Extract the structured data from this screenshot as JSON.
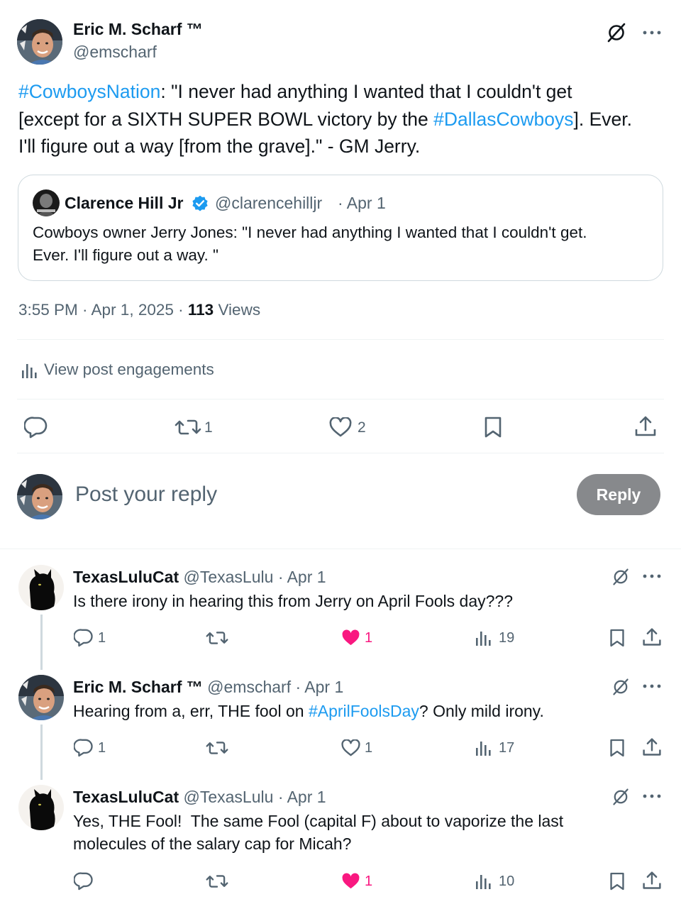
{
  "main_post": {
    "author_name": "Eric M. Scharf ™",
    "author_handle": "@emscharf",
    "text_hashtag_1": "#CowboysNation",
    "text_part_1": ": \"I never had anything I wanted that I couldn't get",
    "text_part_2": "[except for a SIXTH SUPER BOWL victory by the ",
    "text_hashtag_2": "#DallasCowboys",
    "text_part_3": "]. Ever.",
    "text_part_4": "I'll figure out a way [from the grave].\" - GM Jerry.",
    "quoted": {
      "author_name": "Clarence Hill Jr",
      "author_handle": "@clarencehilljr",
      "date": "· Apr 1",
      "text_line_1": "Cowboys owner Jerry Jones: \"I never had anything I wanted that I couldn't get.",
      "text_line_2": "Ever. I'll figure out a way. \""
    },
    "timestamp": "3:55 PM · Apr 1, 2025 · ",
    "views_count": "113",
    "views_label": " Views",
    "engagements_label": "View post engagements",
    "reposts": "1",
    "likes": "2"
  },
  "reply_composer": {
    "placeholder": "Post your reply",
    "button_label": "Reply"
  },
  "replies": [
    {
      "author_name": "TexasLuluCat",
      "author_handle": "@TexasLulu",
      "date": "· Apr 1",
      "text": "Is there irony in hearing this from Jerry on April Fools day???",
      "replies": "1",
      "likes": "1",
      "liked": true,
      "views": "19"
    },
    {
      "author_name": "Eric M. Scharf ™",
      "author_handle": "@emscharf",
      "date": "· Apr 1",
      "text_part_1": "Hearing from a, err, THE fool on ",
      "text_hashtag": "#AprilFoolsDay",
      "text_part_2": "? Only mild irony.",
      "replies": "1",
      "likes": "1",
      "liked": false,
      "views": "17"
    },
    {
      "author_name": "TexasLuluCat",
      "author_handle": "@TexasLulu",
      "date": "· Apr 1",
      "text_line_1": "Yes, THE Fool!  The same Fool (capital F) about to vaporize the last",
      "text_line_2": "molecules of the salary cap for Micah?",
      "likes": "1",
      "liked": true,
      "views": "10"
    }
  ],
  "colors": {
    "link": "#1d9bf0",
    "like_pink": "#f91880",
    "muted": "#536471",
    "reply_button_bg": "#87898c"
  }
}
